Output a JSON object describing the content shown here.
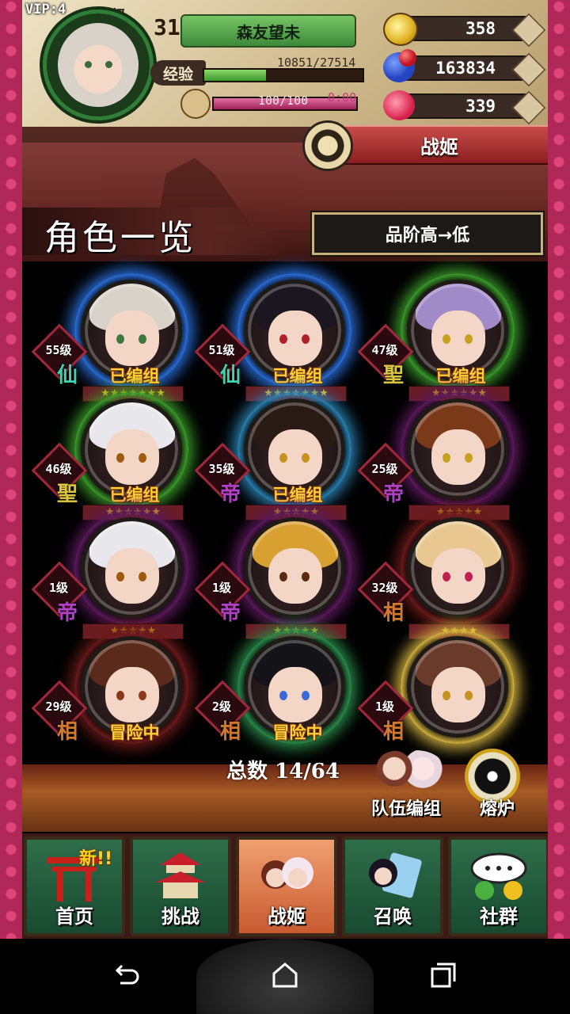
{
  "player": {
    "vip": "VIP:4",
    "level_label": "等级",
    "level": "31",
    "name": "森友望未",
    "exp_label": "经验",
    "exp_text": "10851/27514",
    "exp_fraction": 0.39,
    "stamina_text": "100/100",
    "stamina_fraction": 1.0,
    "stamina_timer": "0:00"
  },
  "currencies": [
    {
      "name": "gold",
      "icon": "gold-coin-icon",
      "value": "358"
    },
    {
      "name": "gems",
      "icon": "orb-icon",
      "value": "163834"
    },
    {
      "name": "hearts",
      "icon": "heart-icon",
      "value": "339"
    }
  ],
  "tab_title": "战姬",
  "list_title": "角色一览",
  "sort_label": "品阶高→低",
  "characters": [
    {
      "level": "55级",
      "rank": "仙",
      "rank_color": "#3fd4b0",
      "status": "已编组",
      "stars": "★★★★★★★",
      "hair": "#d9d2c9",
      "eye": "#3b7a3b",
      "halo": "#2a6ed8"
    },
    {
      "level": "51级",
      "rank": "仙",
      "rank_color": "#3fd4b0",
      "status": "已编组",
      "stars": "★★★★★★★",
      "hair": "#1c1620",
      "eye": "#b0202a",
      "halo": "#2a6ed8"
    },
    {
      "level": "47级",
      "rank": "聖",
      "rank_color": "#d8c640",
      "status": "已编组",
      "stars": "★★★★★★",
      "hair": "#a08ac8",
      "eye": "#c8a020",
      "halo": "#3a9a2a"
    },
    {
      "level": "46级",
      "rank": "聖",
      "rank_color": "#d8c640",
      "status": "已编组",
      "stars": "★★★★★★",
      "hair": "#e8e8ec",
      "eye": "#a05a10",
      "halo": "#3a9a2a"
    },
    {
      "level": "35级",
      "rank": "帝",
      "rank_color": "#b040c8",
      "status": "已编组",
      "stars": "★★★★★",
      "hair": "#2a1a14",
      "eye": "#c89020",
      "halo": "#2a80b0"
    },
    {
      "level": "25级",
      "rank": "帝",
      "rank_color": "#b040c8",
      "status": "",
      "stars": "★★★★★",
      "hair": "#7a3a1a",
      "eye": "#c8a020",
      "halo": "#5a1a5a"
    },
    {
      "level": "1级",
      "rank": "帝",
      "rank_color": "#b040c8",
      "status": "",
      "stars": "★★★★★",
      "hair": "#e8e8ec",
      "eye": "#a05a10",
      "halo": "#5a1a5a"
    },
    {
      "level": "1级",
      "rank": "帝",
      "rank_color": "#b040c8",
      "status": "",
      "stars": "★★★★★",
      "hair": "#d8a030",
      "eye": "#5a2a10",
      "halo": "#5a1a5a"
    },
    {
      "level": "32级",
      "rank": "相",
      "rank_color": "#d07a30",
      "status": "",
      "stars": "★★★★",
      "hair": "#e8c890",
      "eye": "#c02050",
      "halo": "#6a1a1a"
    },
    {
      "level": "29级",
      "rank": "相",
      "rank_color": "#d07a30",
      "status": "冒险中",
      "stars": "",
      "hair": "#5a2a1a",
      "eye": "#8a3a1a",
      "halo": "#6a1a1a"
    },
    {
      "level": "2级",
      "rank": "相",
      "rank_color": "#d07a30",
      "status": "冒险中",
      "stars": "",
      "hair": "#141418",
      "eye": "#3a6ad8",
      "halo": "#2a8a4a"
    },
    {
      "level": "1级",
      "rank": "相",
      "rank_color": "#d07a30",
      "status": "",
      "stars": "",
      "hair": "#6a3a2a",
      "eye": "#c89020",
      "halo": "#d0b040"
    }
  ],
  "total_label": "总数",
  "total_value": "14/64",
  "team_button": "队伍编组",
  "forge_button": "熔炉",
  "nav": [
    {
      "label": "首页",
      "icon": "torii-gate-icon",
      "badge": "新!!"
    },
    {
      "label": "挑战",
      "icon": "pagoda-icon",
      "badge": ""
    },
    {
      "label": "战姬",
      "icon": "princess-icon",
      "badge": ""
    },
    {
      "label": "召唤",
      "icon": "summon-icon",
      "badge": ""
    },
    {
      "label": "社群",
      "icon": "chat-bubble-icon",
      "badge": ""
    }
  ],
  "system_nav": [
    "back-icon",
    "home-icon",
    "recents-icon"
  ]
}
